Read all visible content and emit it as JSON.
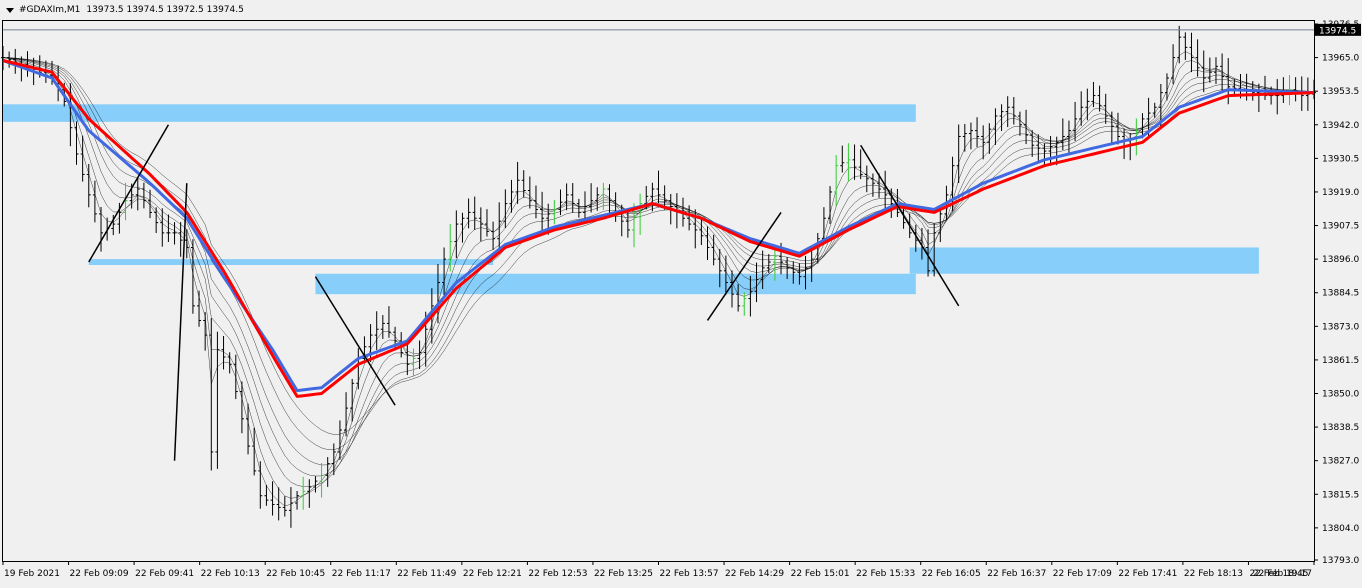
{
  "header": {
    "symbol": "#GDAXIm,M1",
    "ohlc": "13973.5 13974.5 13972.5 13974.5"
  },
  "colors": {
    "background": "#f0f0f0",
    "bars": "#000000",
    "bull_accent": "#32cd32",
    "ema_fast": "#4169e1",
    "ema_slow": "#ff0000",
    "ribbon": "#000000",
    "zone": "#87cefa",
    "price_label_bg": "#000000",
    "price_label_fg": "#ffffff"
  },
  "chart_data": {
    "type": "line",
    "title": "#GDAXIm,M1",
    "current_price_label": "13974.5",
    "ylim": [
      13793.0,
      13976.5
    ],
    "y_ticks": [
      "13976.5",
      "13965.0",
      "13953.5",
      "13942.0",
      "13930.5",
      "13919.0",
      "13907.5",
      "13896.0",
      "13884.5",
      "13873.0",
      "13861.5",
      "13850.0",
      "13838.5",
      "13827.0",
      "13815.5",
      "13804.0",
      "13793.0"
    ],
    "x_ticks": [
      "19 Feb 2021",
      "22 Feb 09:09",
      "22 Feb 09:41",
      "22 Feb 10:13",
      "22 Feb 10:45",
      "22 Feb 11:17",
      "22 Feb 11:49",
      "22 Feb 12:21",
      "22 Feb 12:53",
      "22 Feb 13:25",
      "22 Feb 13:57",
      "22 Feb 14:29",
      "22 Feb 15:01",
      "22 Feb 15:33",
      "22 Feb 16:05",
      "22 Feb 16:37",
      "22 Feb 17:09",
      "22 Feb 17:41",
      "22 Feb 18:13",
      "22 Feb 18:45",
      "22 Feb 19:17"
    ],
    "price_path": [
      [
        0,
        13965
      ],
      [
        4,
        13962
      ],
      [
        8,
        13958
      ],
      [
        10,
        13950
      ],
      [
        12,
        13932
      ],
      [
        14,
        13918
      ],
      [
        16,
        13905
      ],
      [
        18,
        13908
      ],
      [
        20,
        13916
      ],
      [
        22,
        13920
      ],
      [
        24,
        13912
      ],
      [
        26,
        13905
      ],
      [
        28,
        13905
      ],
      [
        30,
        13900
      ],
      [
        31,
        13880
      ],
      [
        33,
        13870
      ],
      [
        34,
        13830
      ],
      [
        35,
        13865
      ],
      [
        37,
        13860
      ],
      [
        40,
        13832
      ],
      [
        42,
        13815
      ],
      [
        44,
        13812
      ],
      [
        46,
        13810
      ],
      [
        48,
        13815
      ],
      [
        50,
        13818
      ],
      [
        52,
        13822
      ],
      [
        54,
        13830
      ],
      [
        56,
        13845
      ],
      [
        58,
        13862
      ],
      [
        60,
        13870
      ],
      [
        62,
        13874
      ],
      [
        64,
        13868
      ],
      [
        66,
        13860
      ],
      [
        68,
        13864
      ],
      [
        70,
        13880
      ],
      [
        72,
        13896
      ],
      [
        74,
        13908
      ],
      [
        76,
        13912
      ],
      [
        78,
        13908
      ],
      [
        80,
        13903
      ],
      [
        82,
        13915
      ],
      [
        84,
        13923
      ],
      [
        86,
        13916
      ],
      [
        88,
        13910
      ],
      [
        90,
        13913
      ],
      [
        92,
        13918
      ],
      [
        94,
        13912
      ],
      [
        96,
        13916
      ],
      [
        98,
        13920
      ],
      [
        100,
        13912
      ],
      [
        102,
        13906
      ],
      [
        104,
        13915
      ],
      [
        106,
        13920
      ],
      [
        108,
        13916
      ],
      [
        110,
        13912
      ],
      [
        112,
        13908
      ],
      [
        114,
        13904
      ],
      [
        116,
        13896
      ],
      [
        118,
        13888
      ],
      [
        120,
        13880
      ],
      [
        122,
        13885
      ],
      [
        124,
        13893
      ],
      [
        126,
        13897
      ],
      [
        128,
        13893
      ],
      [
        130,
        13890
      ],
      [
        132,
        13896
      ],
      [
        134,
        13910
      ],
      [
        136,
        13928
      ],
      [
        138,
        13930
      ],
      [
        140,
        13925
      ],
      [
        142,
        13922
      ],
      [
        144,
        13918
      ],
      [
        146,
        13912
      ],
      [
        148,
        13905
      ],
      [
        150,
        13900
      ],
      [
        151,
        13892
      ],
      [
        152,
        13905
      ],
      [
        154,
        13918
      ],
      [
        156,
        13938
      ],
      [
        158,
        13940
      ],
      [
        160,
        13936
      ],
      [
        162,
        13945
      ],
      [
        164,
        13948
      ],
      [
        166,
        13942
      ],
      [
        168,
        13935
      ],
      [
        170,
        13933
      ],
      [
        172,
        13936
      ],
      [
        174,
        13940
      ],
      [
        176,
        13948
      ],
      [
        178,
        13952
      ],
      [
        180,
        13945
      ],
      [
        182,
        13938
      ],
      [
        184,
        13935
      ],
      [
        186,
        13944
      ],
      [
        188,
        13948
      ],
      [
        190,
        13958
      ],
      [
        192,
        13972
      ],
      [
        194,
        13965
      ],
      [
        196,
        13958
      ],
      [
        198,
        13962
      ],
      [
        200,
        13955
      ],
      [
        202,
        13954
      ],
      [
        204,
        13953
      ],
      [
        206,
        13952
      ],
      [
        208,
        13952
      ],
      [
        210,
        13954
      ],
      [
        212,
        13952
      ],
      [
        214,
        13953
      ]
    ],
    "ema_fast_path": [
      [
        0,
        13964
      ],
      [
        8,
        13958
      ],
      [
        14,
        13940
      ],
      [
        24,
        13922
      ],
      [
        30,
        13910
      ],
      [
        36,
        13890
      ],
      [
        44,
        13865
      ],
      [
        48,
        13851
      ],
      [
        52,
        13852
      ],
      [
        58,
        13862
      ],
      [
        66,
        13868
      ],
      [
        74,
        13888
      ],
      [
        82,
        13901
      ],
      [
        90,
        13907
      ],
      [
        98,
        13911
      ],
      [
        106,
        13915
      ],
      [
        114,
        13910
      ],
      [
        122,
        13903
      ],
      [
        130,
        13898
      ],
      [
        138,
        13907
      ],
      [
        146,
        13915
      ],
      [
        152,
        13913
      ],
      [
        160,
        13922
      ],
      [
        170,
        13930
      ],
      [
        180,
        13935
      ],
      [
        186,
        13938
      ],
      [
        192,
        13948
      ],
      [
        200,
        13954
      ],
      [
        214,
        13953
      ]
    ],
    "ema_slow_path": [
      [
        0,
        13964
      ],
      [
        8,
        13960
      ],
      [
        14,
        13944
      ],
      [
        24,
        13925
      ],
      [
        30,
        13912
      ],
      [
        36,
        13892
      ],
      [
        44,
        13863
      ],
      [
        48,
        13849
      ],
      [
        52,
        13850
      ],
      [
        58,
        13860
      ],
      [
        66,
        13867
      ],
      [
        74,
        13886
      ],
      [
        82,
        13900
      ],
      [
        90,
        13906
      ],
      [
        98,
        13910
      ],
      [
        106,
        13915
      ],
      [
        114,
        13910
      ],
      [
        122,
        13902
      ],
      [
        130,
        13897
      ],
      [
        138,
        13906
      ],
      [
        146,
        13914
      ],
      [
        152,
        13912
      ],
      [
        160,
        13920
      ],
      [
        170,
        13928
      ],
      [
        180,
        13933
      ],
      [
        186,
        13936
      ],
      [
        192,
        13946
      ],
      [
        200,
        13952
      ],
      [
        214,
        13953
      ]
    ],
    "zones": [
      {
        "x_start": 0,
        "x_end": 149,
        "y_bottom": 13943,
        "y_top": 13949
      },
      {
        "x_start": 51,
        "x_end": 149,
        "y_bottom": 13884,
        "y_top": 13891
      },
      {
        "x_start": 14,
        "x_end": 80,
        "y_bottom": 13894,
        "y_top": 13896
      },
      {
        "x_start": 148,
        "x_end": 205,
        "y_bottom": 13891,
        "y_top": 13900
      }
    ],
    "trendlines": [
      {
        "x0": 14,
        "y0": 13895,
        "x1": 27,
        "y1": 13942
      },
      {
        "x0": 28,
        "y0": 13827,
        "x1": 30,
        "y1": 13922
      },
      {
        "x0": 51,
        "y0": 13890,
        "x1": 64,
        "y1": 13846
      },
      {
        "x0": 115,
        "y0": 13875,
        "x1": 127,
        "y1": 13912
      },
      {
        "x0": 140,
        "y0": 13935,
        "x1": 156,
        "y1": 13880
      }
    ]
  }
}
